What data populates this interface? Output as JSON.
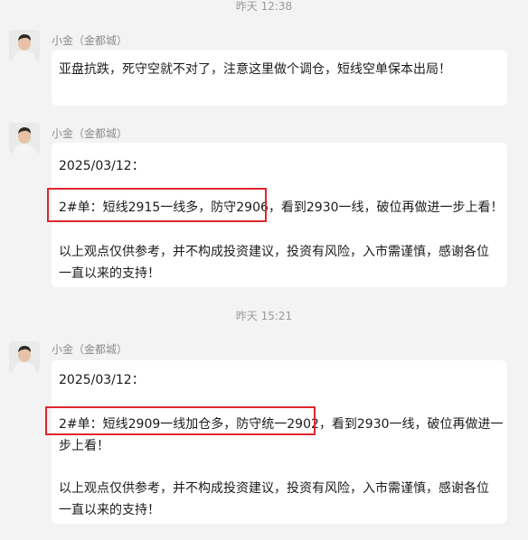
{
  "timestamps": {
    "top": "昨天 12:38",
    "middle": "昨天 15:21"
  },
  "messages": [
    {
      "sender": "小金（金都城）",
      "lines": [
        "亚盘抗跌，死守空就不对了，注意这里做个调仓，短线空单保本出局！"
      ]
    },
    {
      "sender": "小金（金都城）",
      "lines": [
        "2025/03/12：",
        "2#单：短线2915一线多，防守2906，看到2930一线，破位再做进一步上看！",
        "以上观点仅供参考，并不构成投资建议，投资有风险，入市需谨慎，感谢各位",
        "一直以来的支持！"
      ]
    },
    {
      "sender": "小金（金都城）",
      "lines": [
        "2025/03/12：",
        "2#单：短线2909一线加仓多，防守统一2902，看到2930一线，破位再做进一",
        "步上看！",
        "以上观点仅供参考，并不构成投资建议，投资有风险，入市需谨慎，感谢各位",
        "一直以来的支持！"
      ]
    }
  ]
}
